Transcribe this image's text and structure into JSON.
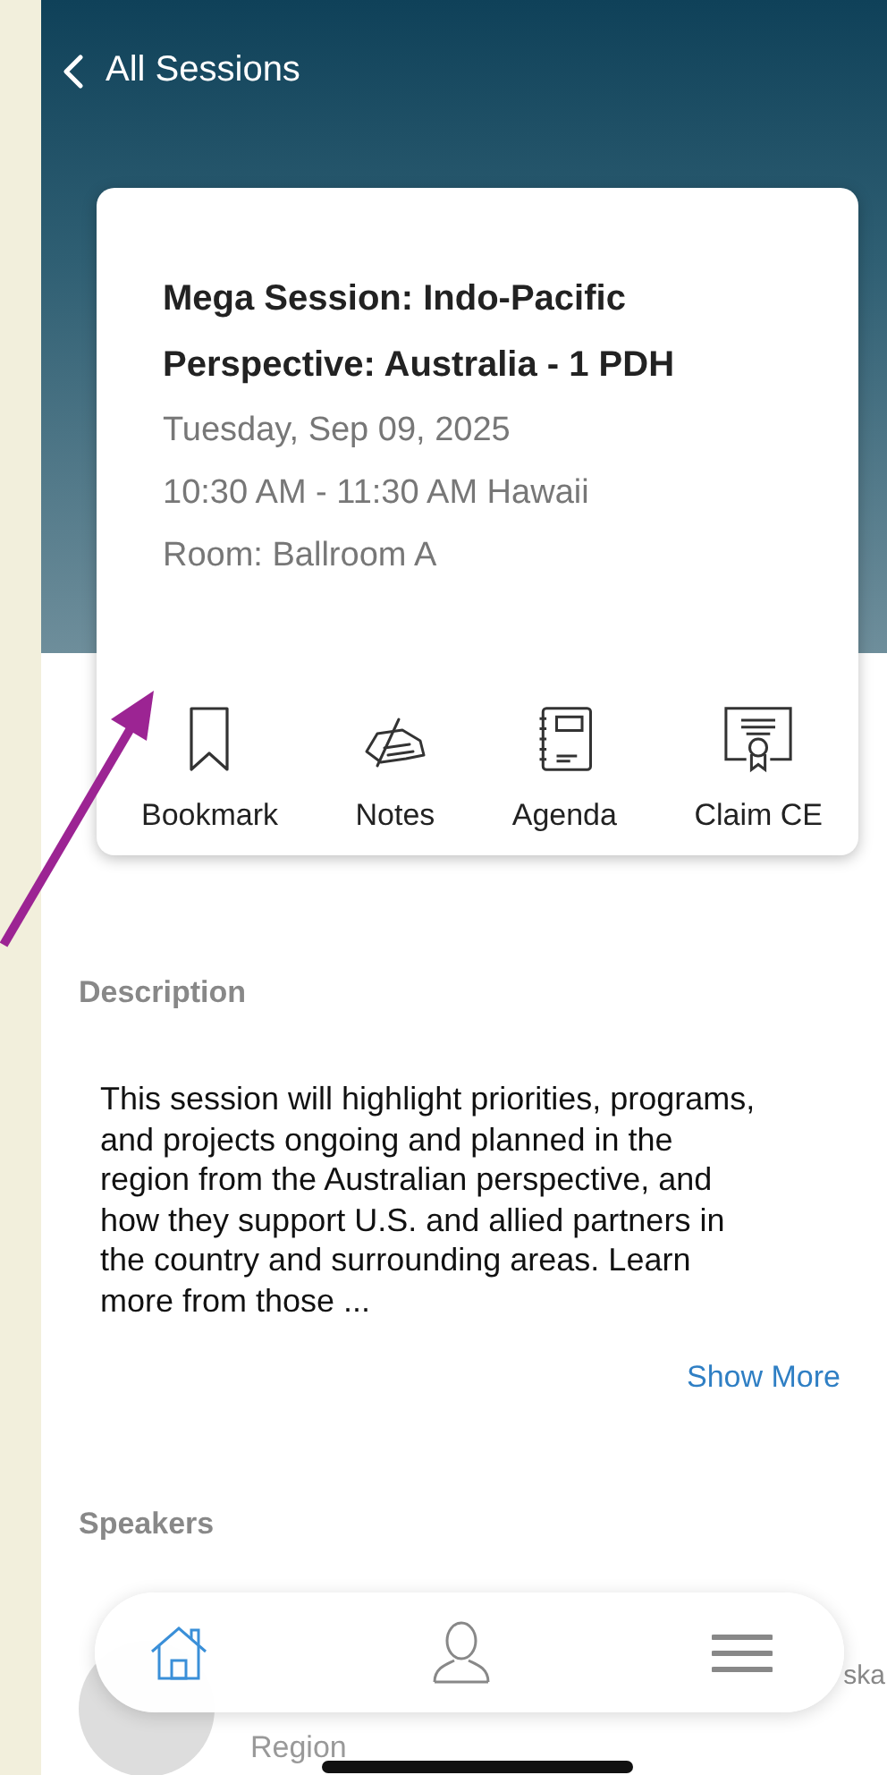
{
  "header": {
    "back_label": "All Sessions"
  },
  "session": {
    "title": "Mega Session: Indo-Pacific Perspective: Australia - 1 PDH",
    "date": "Tuesday, Sep 09, 2025",
    "time": "10:30 AM - 11:30 AM Hawaii",
    "room": "Room: Ballroom A"
  },
  "actions": [
    {
      "kind": "bookmark",
      "label": "Bookmark"
    },
    {
      "kind": "notes",
      "label": "Notes"
    },
    {
      "kind": "agenda",
      "label": "Agenda"
    },
    {
      "kind": "certificate",
      "label": "Claim CE"
    }
  ],
  "description": {
    "heading": "Description",
    "text": "This session will highlight priorities, programs, and projects ongoing and planned in the region from the Australian perspective, and how they support U.S. and allied partners in the country and surrounding areas. Learn more from those ...",
    "more_link": "Show More"
  },
  "speakers": {
    "heading": "Speakers",
    "items": [
      {
        "role_tail": "ska",
        "role_line2": "Region"
      }
    ]
  },
  "nav": [
    {
      "kind": "home",
      "selected": true
    },
    {
      "kind": "profile",
      "selected": false
    },
    {
      "kind": "menu",
      "selected": false
    }
  ]
}
